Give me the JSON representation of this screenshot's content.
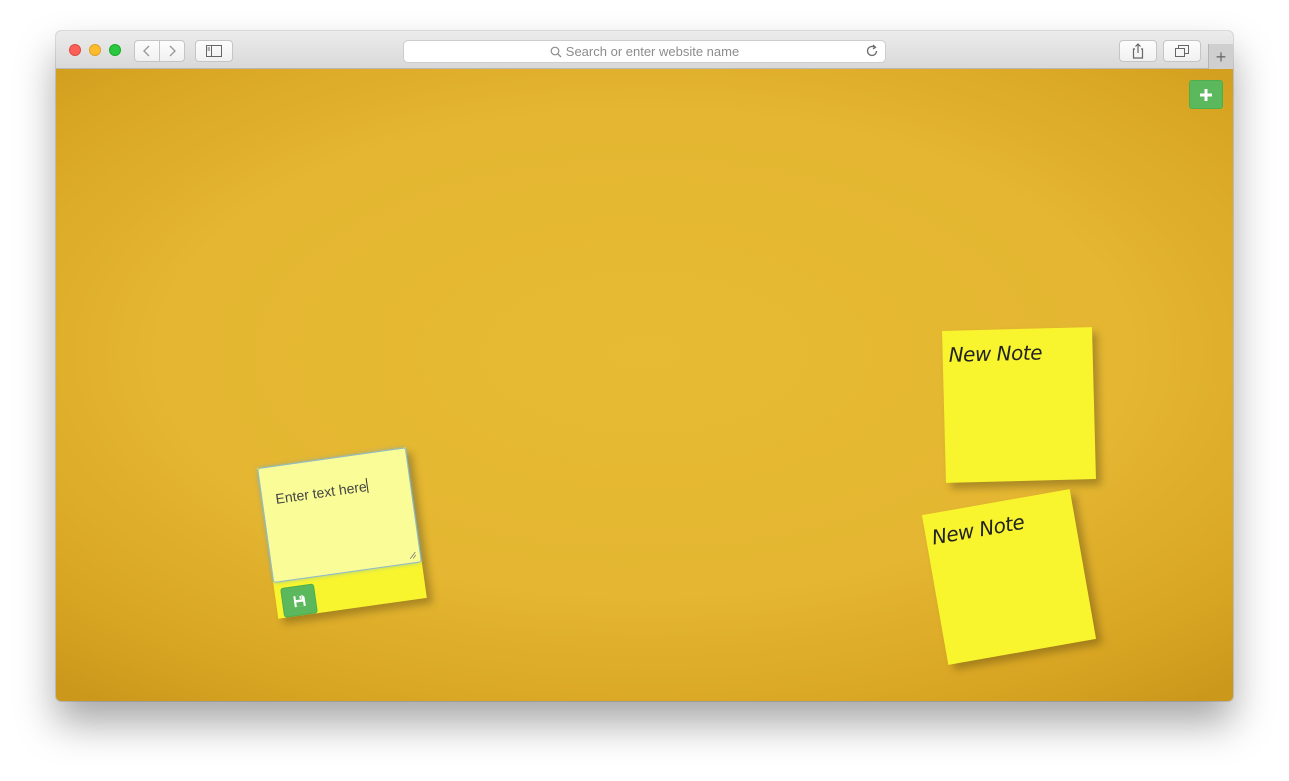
{
  "browser": {
    "address_placeholder": "Search or enter website name",
    "new_tab_label": "+"
  },
  "app": {
    "add_note_label": "+",
    "notes": [
      {
        "title": "New Note"
      },
      {
        "title": "New Note"
      }
    ],
    "editing_note": {
      "text": "Enter text here"
    }
  },
  "colors": {
    "board": "#e4b631",
    "note": "#f8f52e",
    "note_editing_textarea": "#fafd97",
    "button_green": "#5cb85c"
  },
  "icons": {
    "add_note": "plus-icon",
    "save": "floppy-disk-icon"
  }
}
